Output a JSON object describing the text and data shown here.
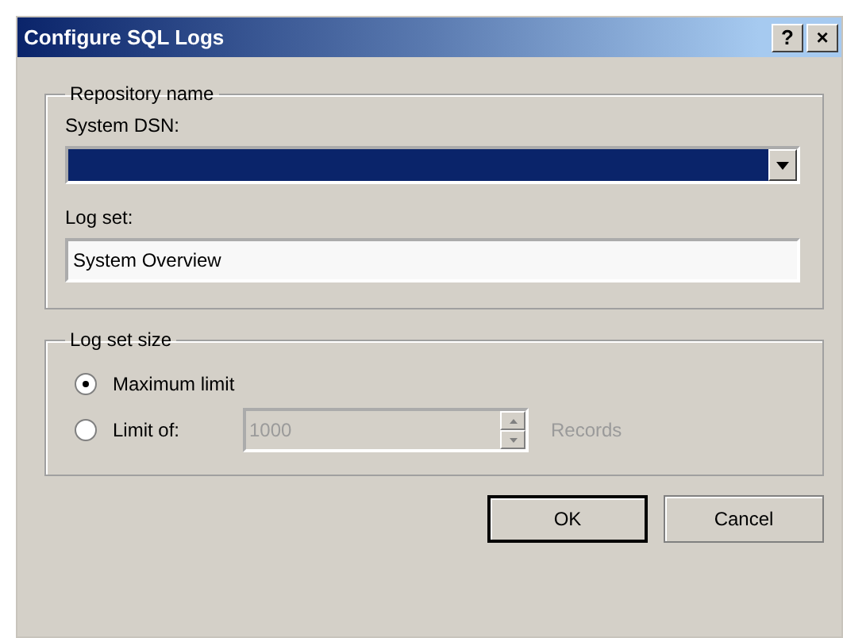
{
  "window": {
    "title": "Configure SQL Logs",
    "title_buttons": [
      "?",
      "×"
    ]
  },
  "repository": {
    "legend": "Repository name",
    "dsn_label": "System DSN:",
    "dsn_selected": true,
    "logset_label": "Log set:",
    "logset_value": "System Overview"
  },
  "size": {
    "legend": "Log set size",
    "options": [
      {
        "label": "Maximum limit",
        "selected": true
      },
      {
        "label": "Limit of:",
        "selected": false
      }
    ],
    "limit_value": "1000",
    "limit_disabled": true,
    "unit": "Records"
  },
  "buttons": [
    {
      "label": "OK",
      "default": true
    },
    {
      "label": "Cancel",
      "default": false
    }
  ]
}
